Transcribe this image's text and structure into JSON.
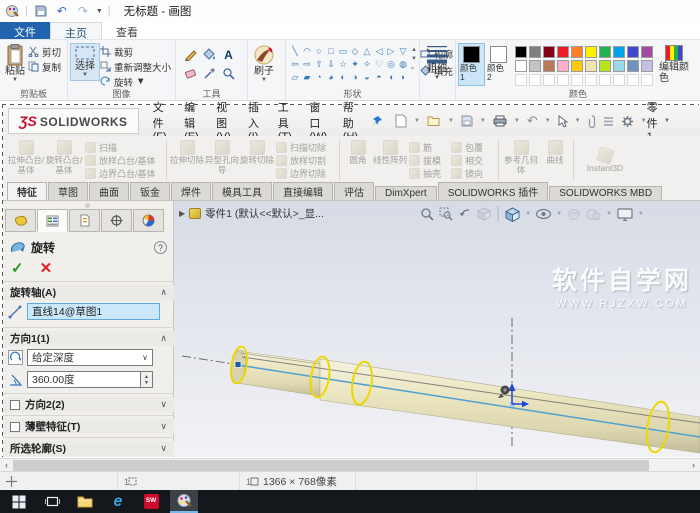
{
  "paint": {
    "title": "无标题 - 画图",
    "tabs": {
      "file": "文件",
      "home": "主页",
      "view": "查看"
    },
    "clipboard": {
      "group": "剪贴板",
      "paste": "粘贴",
      "cut": "剪切",
      "copy": "复制"
    },
    "image": {
      "group": "图像",
      "select": "选择",
      "crop": "裁剪",
      "resize": "重新调整大小",
      "rotate": "旋转"
    },
    "tools": {
      "group": "工具"
    },
    "brush": "刷子",
    "shapes": {
      "group": "形状",
      "outline": "轮廓",
      "fill": "填充",
      "rows": [
        [
          "╲",
          "◠",
          "○",
          "□",
          "▭",
          "◇",
          "△",
          "◁",
          "▷",
          "▽"
        ],
        [
          "⇦",
          "⇨",
          "⇧",
          "⇩",
          "☆",
          "✦",
          "✧",
          "♡",
          "◎",
          "◍"
        ],
        [
          "▱",
          "▰",
          "◔",
          "◕",
          "◐",
          "◑",
          "◒",
          "◓",
          "◖",
          "◗"
        ]
      ]
    },
    "size": "粗细",
    "colors": {
      "group": "颜色",
      "color1": "颜色 1",
      "color2": "颜色 2",
      "edit": "编辑颜色",
      "color1_value": "#000000",
      "color2_value": "#ffffff",
      "row1": [
        "#000000",
        "#7f7f7f",
        "#880015",
        "#ed1c24",
        "#ff7f27",
        "#fff200",
        "#22b14c",
        "#00a2e8",
        "#3f48cc",
        "#a349a4"
      ],
      "row2": [
        "#ffffff",
        "#c3c3c3",
        "#b97a57",
        "#ffaec9",
        "#ffc90e",
        "#efe4b0",
        "#b5e61d",
        "#99d9ea",
        "#7092be",
        "#c8bfe7"
      ]
    },
    "status": {
      "size_text": "1366 × 768像素"
    }
  },
  "solidworks": {
    "logo_mark": "ƷS",
    "logo_text": "SOLIDWORKS",
    "menus": [
      "文件(F)",
      "编辑(E)",
      "视图(V)",
      "插入(I)",
      "工具(T)",
      "窗口(W)",
      "帮助(H)"
    ],
    "doc_button": "零件1",
    "features": [
      "拉伸凸台/基体",
      "旋转凸台/基体",
      "扫描",
      "放样凸台/基体",
      "边界凸台/基体",
      "拉伸切除",
      "异型孔向导",
      "旋转切除",
      "扫描切除",
      "放样切割",
      "边界切除",
      "圆角",
      "线性阵列",
      "筋",
      "拔模",
      "抽壳",
      "包覆",
      "相交",
      "镜向",
      "参考几何体",
      "曲线",
      "Instant3D"
    ],
    "tabs": [
      "特征",
      "草图",
      "曲面",
      "钣金",
      "焊件",
      "模具工具",
      "直接编辑",
      "评估",
      "DimXpert",
      "SOLIDWORKS 插件",
      "SOLIDWORKS MBD"
    ],
    "active_tab": "特征",
    "pm": {
      "title": "旋转",
      "help": "?",
      "ok": "✓",
      "cancel": "✕",
      "axis_section": "旋转轴(A)",
      "axis_value": "直线14@草图1",
      "dir1_section": "方向1(1)",
      "end_condition": "给定深度",
      "angle_value": "360.00度",
      "dir2_section": "方向2(2)",
      "thin_section": "薄壁特征(T)",
      "contours_section": "所选轮廓(S)"
    },
    "tree_label": "零件1 (默认<<默认>_显...",
    "watermark_line1": "软件自学网",
    "watermark_line2": "WWW.RJZXW.COM",
    "accent_colors": {
      "preview_yellow": "#ece7c3",
      "highlight_yellow": "#ecd800",
      "sketch_blue": "#4f9fd0"
    }
  },
  "taskbar": {
    "sw_label": "SW",
    "edge_label": "e"
  }
}
